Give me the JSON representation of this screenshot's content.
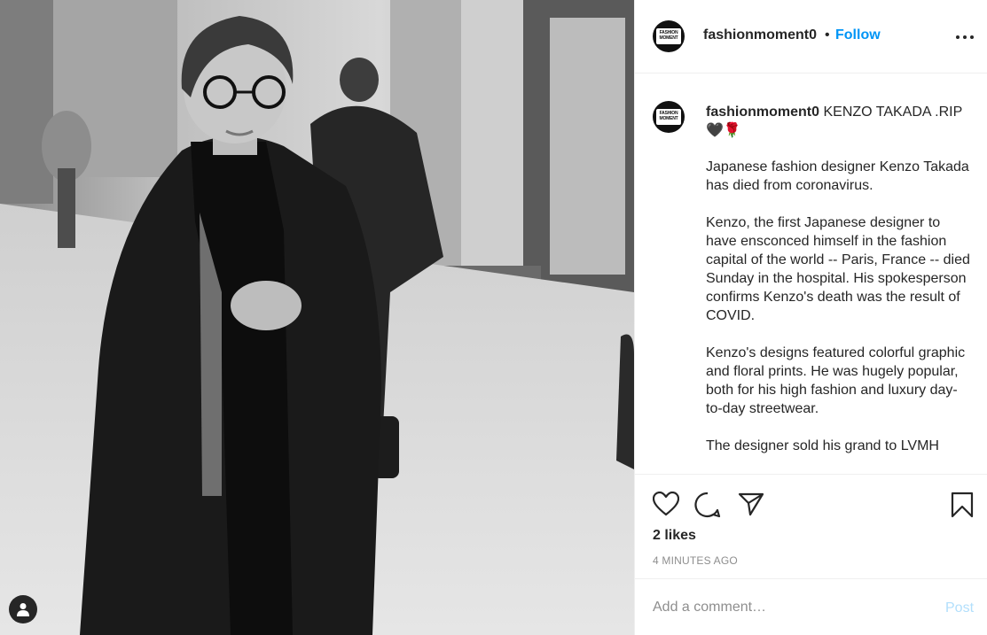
{
  "post": {
    "username": "fashionmoment0",
    "follow_label": "Follow",
    "separator": "•",
    "avatar_text": "FASHION MOMENT"
  },
  "caption": {
    "username": "fashionmoment0",
    "headline": "KENZO TAKADA .RIP🖤🌹",
    "paragraphs": [
      "Japanese fashion designer Kenzo Takada has died from coronavirus.",
      "Kenzo, the first Japanese designer to have ensconced himself in the fashion capital of the world -- Paris, France -- died Sunday in the hospital. His spokesperson confirms Kenzo's death was the result of COVID.",
      "Kenzo's designs featured colorful graphic and floral prints. He was hugely popular, both for his high fashion and luxury day-to-day streetwear.",
      "The designer sold his grand to LVMH"
    ]
  },
  "stats": {
    "likes": "2 likes",
    "time": "4 MINUTES AGO"
  },
  "comment": {
    "placeholder": "Add a comment…",
    "post_label": "Post"
  },
  "icons": {
    "like": "heart-icon",
    "comment": "comment-icon",
    "share": "paper-plane-icon",
    "save": "bookmark-icon",
    "more": "ellipsis-icon",
    "tag": "user-tag-icon"
  },
  "colors": {
    "accent": "#0095f6",
    "post_disabled": "#b2dffc",
    "muted": "#8e8e8e",
    "text": "#262626"
  }
}
